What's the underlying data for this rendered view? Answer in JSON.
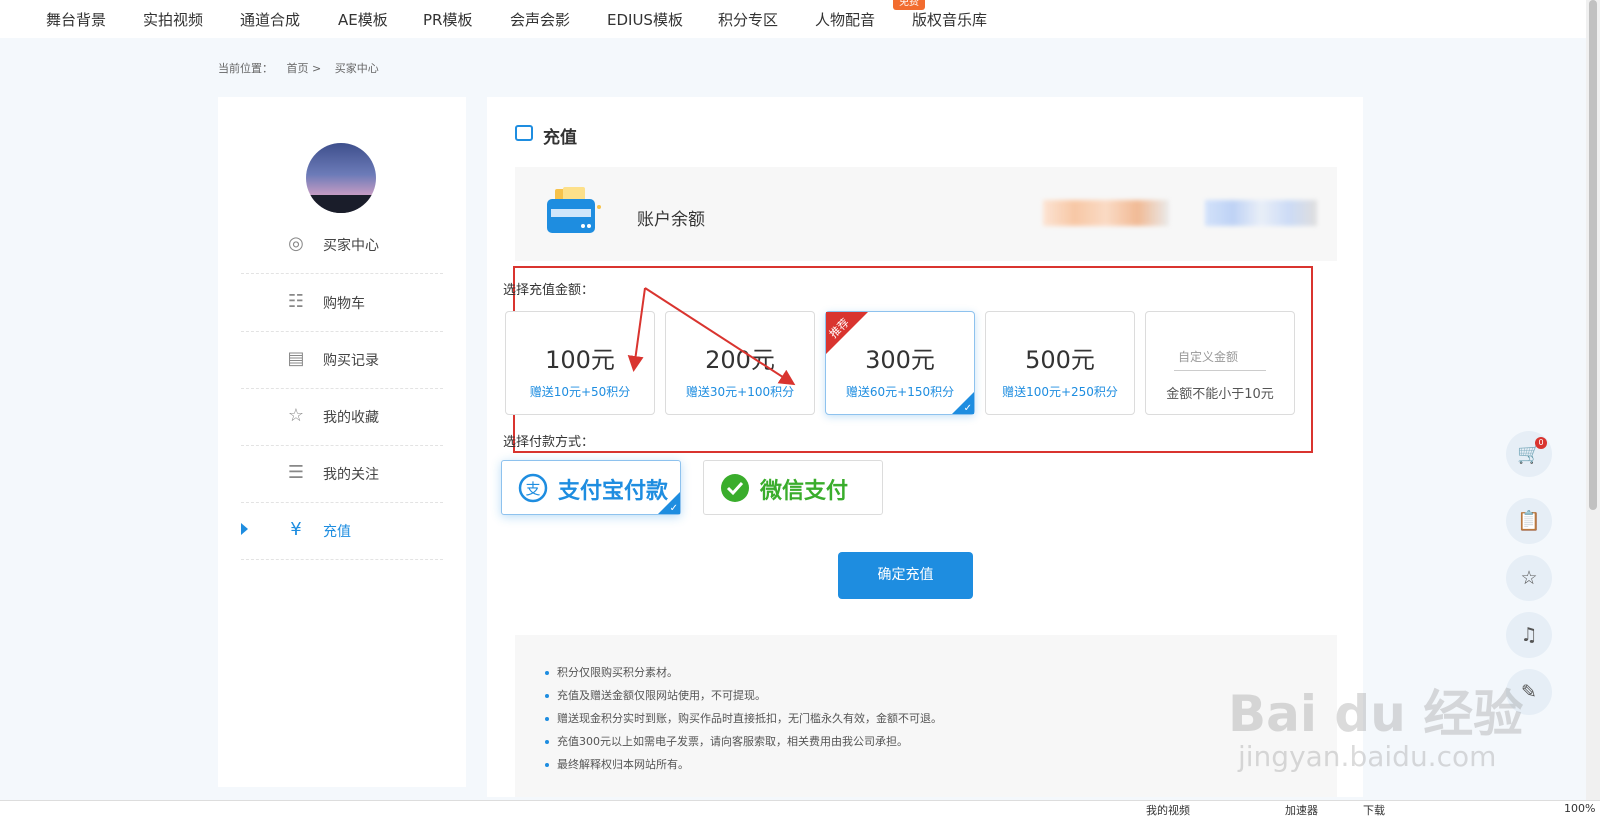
{
  "topnav": {
    "items": [
      "舞台背景",
      "实拍视频",
      "通道合成",
      "AE模板",
      "PR模板",
      "会声会影",
      "EDIUS模板",
      "积分专区",
      "人物配音",
      "版权音乐库"
    ],
    "badge": "免费"
  },
  "breadcrumb": {
    "label": "当前位置：",
    "home": "首页 >",
    "current": "买家中心"
  },
  "sidebar": {
    "items": [
      {
        "label": "买家中心",
        "icon": "user-circle-icon"
      },
      {
        "label": "购物车",
        "icon": "cart-icon"
      },
      {
        "label": "购买记录",
        "icon": "records-icon"
      },
      {
        "label": "我的收藏",
        "icon": "star-icon"
      },
      {
        "label": "我的关注",
        "icon": "list-icon"
      },
      {
        "label": "充值",
        "icon": "recharge-icon",
        "active": true
      }
    ]
  },
  "main": {
    "title": "充值",
    "balance_label": "账户余额",
    "amount_label": "选择充值金额：",
    "payment_label": "选择付款方式：",
    "amounts": [
      {
        "amount": "100元",
        "gift": "赠送10元+50积分"
      },
      {
        "amount": "200元",
        "gift": "赠送30元+100积分"
      },
      {
        "amount": "300元",
        "gift": "赠送60元+150积分",
        "ribbon": "推荐",
        "selected": true
      },
      {
        "amount": "500元",
        "gift": "赠送100元+250积分"
      }
    ],
    "custom": {
      "placeholder": "自定义金额",
      "note": "金额不能小于10元"
    },
    "payments": [
      {
        "label": "支付宝付款",
        "icon": "alipay-icon",
        "color": "#1e8de0",
        "selected": true
      },
      {
        "label": "微信支付",
        "icon": "wechat-icon",
        "color": "#3aad2c"
      }
    ],
    "confirm": "确定充值",
    "notes": [
      "积分仅限购买积分素材。",
      "充值及赠送金额仅限网站使用，不可提现。",
      "赠送现金积分实时到账，购买作品时直接抵扣，无门槛永久有效，金额不可退。",
      "充值300元以上如需电子发票，请向客服索取，相关费用由我公司承担。",
      "最终解释权归本网站所有。"
    ]
  },
  "floating": {
    "cart_count": "0"
  },
  "statusbar": {
    "items": [
      "我的视频",
      "加速器",
      "下载",
      "100%"
    ]
  },
  "watermark": {
    "brand": "Bai du 经验",
    "url": "jingyan.baidu.com"
  },
  "colors": {
    "accent": "#1e8de0",
    "highlight": "#d9342f",
    "wechat": "#3aad2c"
  }
}
